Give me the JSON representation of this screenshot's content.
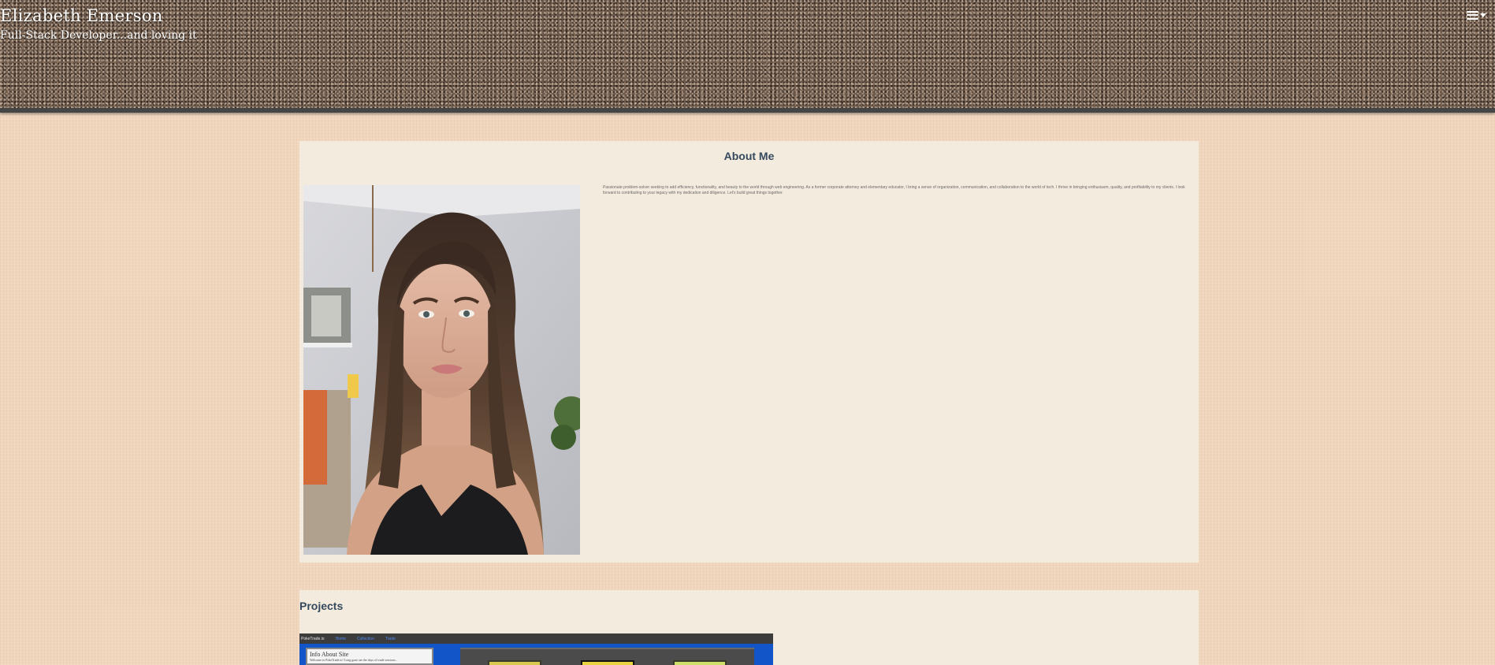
{
  "header": {
    "title": "Elizabeth Emerson",
    "tagline": "Full-Stack Developer...and loving it",
    "menu_icon": "hamburger-menu-icon"
  },
  "about": {
    "heading": "About Me",
    "bio": "Passionate problem-solver seeking to add efficiency, functionality, and beauty to the world through web engineering. As a former corporate attorney and elementary educator, I bring a sense of organization, communication, and collaboration to the world of tech. I thrive in bringing enthusiasm, quality, and profitability to my clients. I look forward to contributing to your legacy with my dedication and diligence. Let's build great things together."
  },
  "projects": {
    "heading": "Projects",
    "thumbnail": {
      "brand": "PokeTrade.io",
      "nav_links": [
        "Home",
        "Collection",
        "Trade"
      ],
      "info_title": "Info About Site",
      "info_text": "Welcome to PokeTrade.io! Long gone are the days of trade sessions..."
    }
  },
  "colors": {
    "page_background": "#f0d6bd",
    "panel_background": "#f3ebde",
    "heading_color": "#34495e",
    "header_border": "#454545"
  }
}
